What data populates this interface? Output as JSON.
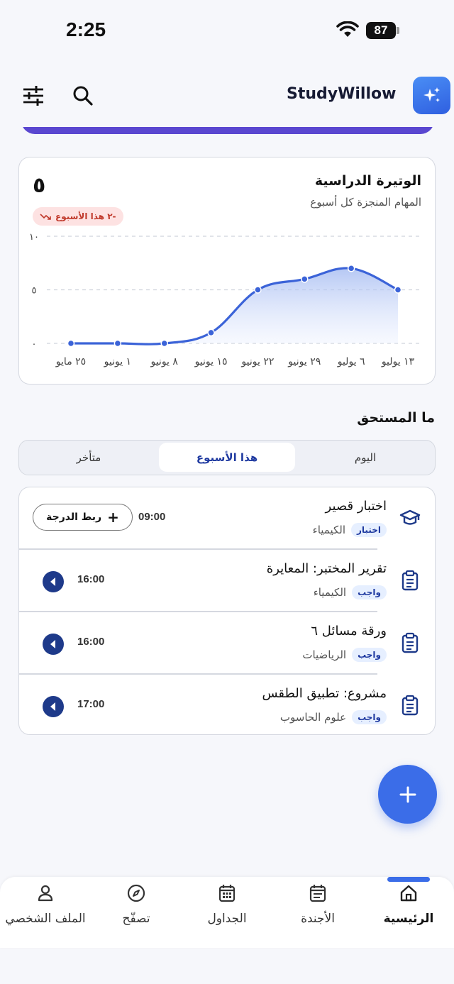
{
  "status_bar": {
    "time": "2:25",
    "battery": "87"
  },
  "header": {
    "app_title": "StudyWillow"
  },
  "pace_card": {
    "title": "الوتيرة الدراسية",
    "subtitle": "المهام المنجزة كل أسبوع",
    "value": "٥",
    "trend": "-٢ هذا الأسبوع"
  },
  "chart_data": {
    "type": "area",
    "x": [
      "٢٥ مايو",
      "١ يونيو",
      "٨ يونيو",
      "١٥ يونيو",
      "٢٢ يونيو",
      "٢٩ يونيو",
      "٦ يوليو",
      "١٣ يوليو"
    ],
    "series": [
      {
        "values": [
          0,
          0,
          0,
          1,
          5,
          6,
          7,
          5
        ]
      }
    ],
    "y_ticks": [
      "٠",
      "٥",
      "١٠"
    ],
    "ylim": [
      0,
      10
    ],
    "grid": true,
    "accent_color": "#3b63d8"
  },
  "due": {
    "title": "ما المستحق",
    "tabs": [
      "اليوم",
      "هذا الأسبوع",
      "متأخر"
    ],
    "active_tab": "هذا الأسبوع",
    "tasks": [
      {
        "title": "اختبار قصير",
        "tag": "اختبار",
        "course": "الكيمياء",
        "time": "09:00",
        "icon": "graduation-cap-icon",
        "action": "ربط الدرجة"
      },
      {
        "title": "تقرير المختبر: المعايرة",
        "tag": "واجب",
        "course": "الكيمياء",
        "time": "16:00",
        "icon": "clipboard-icon"
      },
      {
        "title": "ورقة مسائل ٦",
        "tag": "واجب",
        "course": "الرياضيات",
        "time": "16:00",
        "icon": "clipboard-icon"
      },
      {
        "title": "مشروع: تطبيق الطقس",
        "tag": "واجب",
        "course": "علوم الحاسوب",
        "time": "17:00",
        "icon": "clipboard-icon"
      }
    ]
  },
  "bottom_nav": {
    "items": [
      {
        "label": "الرئيسية",
        "icon": "home-icon"
      },
      {
        "label": "الأجندة",
        "icon": "agenda-icon"
      },
      {
        "label": "الجداول",
        "icon": "calendar-grid-icon"
      },
      {
        "label": "تصفّح",
        "icon": "compass-icon"
      },
      {
        "label": "الملف الشخصي",
        "icon": "profile-icon"
      }
    ],
    "active": "الرئيسية"
  }
}
